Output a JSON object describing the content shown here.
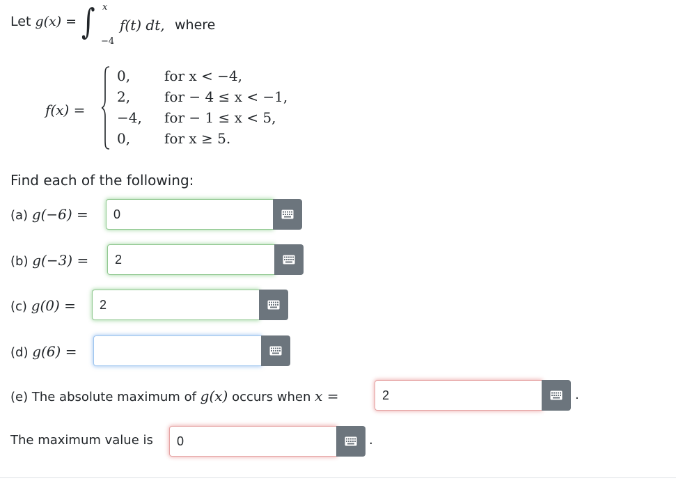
{
  "header": {
    "let": "Let",
    "g_lhs": "g(x) =",
    "upper": "x",
    "lower": "−4",
    "integrand": "f(t) dt,",
    "where": "where"
  },
  "piecewise": {
    "label": "f(x) =",
    "rows": [
      {
        "value": "0,",
        "condition": "for  x < −4,"
      },
      {
        "value": "2,",
        "condition": "for  − 4 ≤ x < −1,"
      },
      {
        "value": "−4,",
        "condition": "for  − 1 ≤ x < 5,"
      },
      {
        "value": "0,",
        "condition": "for  x ≥ 5."
      }
    ]
  },
  "prompt": "Find each of the following:",
  "questions": {
    "a": {
      "prefix": "(a)",
      "expr": "g(−6) =",
      "value": "0"
    },
    "b": {
      "prefix": "(b)",
      "expr": "g(−3) =",
      "value": "2"
    },
    "c": {
      "prefix": "(c)",
      "expr": "g(0) =",
      "value": "2"
    },
    "d": {
      "prefix": "(d)",
      "expr": "g(6) =",
      "value": ""
    },
    "e": {
      "text": "(e) The absolute maximum of",
      "expr": "g(x)",
      "text2": "occurs when",
      "expr2": "x =",
      "value": "2",
      "period": "."
    },
    "max": {
      "text": "The maximum value is",
      "value": "0",
      "period": "."
    }
  },
  "icons": {
    "keyboard": "keyboard-icon"
  },
  "colors": {
    "button": "#6c757d",
    "correct": "#8fc78f",
    "wrong": "#e5a3a3",
    "focus": "#9ec5ef"
  }
}
